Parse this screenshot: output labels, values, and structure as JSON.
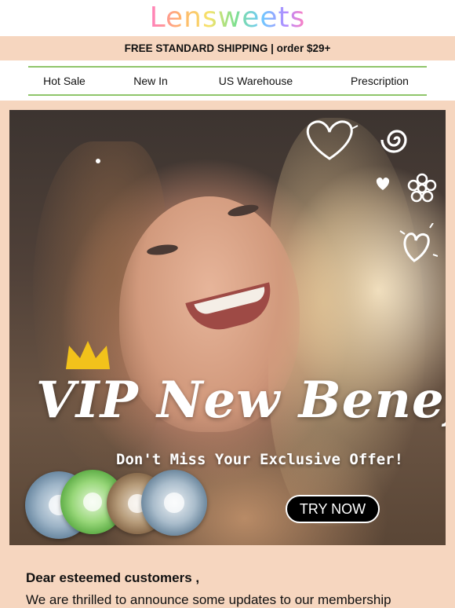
{
  "brand": {
    "logo_text": "Lensweets"
  },
  "shipping_banner": {
    "text": "FREE STANDARD SHIPPING | order $29+"
  },
  "nav": {
    "items": [
      {
        "label": "Hot Sale"
      },
      {
        "label": "New In"
      },
      {
        "label": "US Warehouse"
      },
      {
        "label": "Prescription"
      }
    ]
  },
  "hero": {
    "headline": "VIP New Benefit",
    "subheadline": "Don't Miss Your Exclusive Offer!",
    "cta_label": "TRY NOW"
  },
  "letter": {
    "greeting": "Dear esteemed customers ,",
    "paragraph": "We are thrilled to announce some updates to our membership"
  },
  "colors": {
    "peach": "#f6d6bf",
    "nav_rule": "#8fc56b",
    "cta_bg": "#000000",
    "crown": "#f2c21b"
  }
}
